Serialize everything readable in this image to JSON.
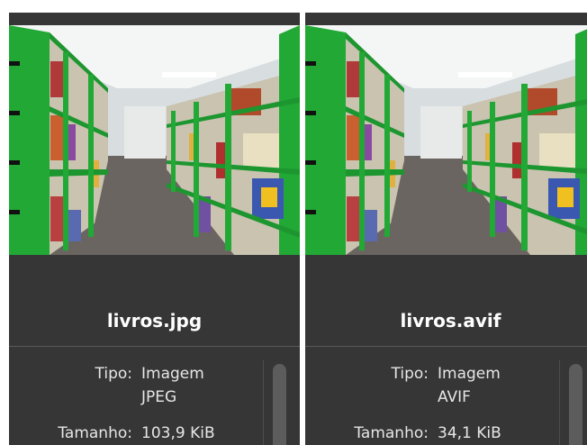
{
  "panels": [
    {
      "filename": "livros.jpg",
      "type_label": "Tipo:",
      "type_value_line1": "Imagem",
      "type_value_line2": "JPEG",
      "size_label": "Tamanho:",
      "size_value": "103,9 KiB"
    },
    {
      "filename": "livros.avif",
      "type_label": "Tipo:",
      "type_value_line1": "Imagem",
      "type_value_line2": "AVIF",
      "size_label": "Tamanho:",
      "size_value": "34,1 KiB"
    }
  ],
  "colors": {
    "panel_bg": "#363636",
    "shelf_green": "#22a835",
    "text": "#e6e6e6"
  }
}
